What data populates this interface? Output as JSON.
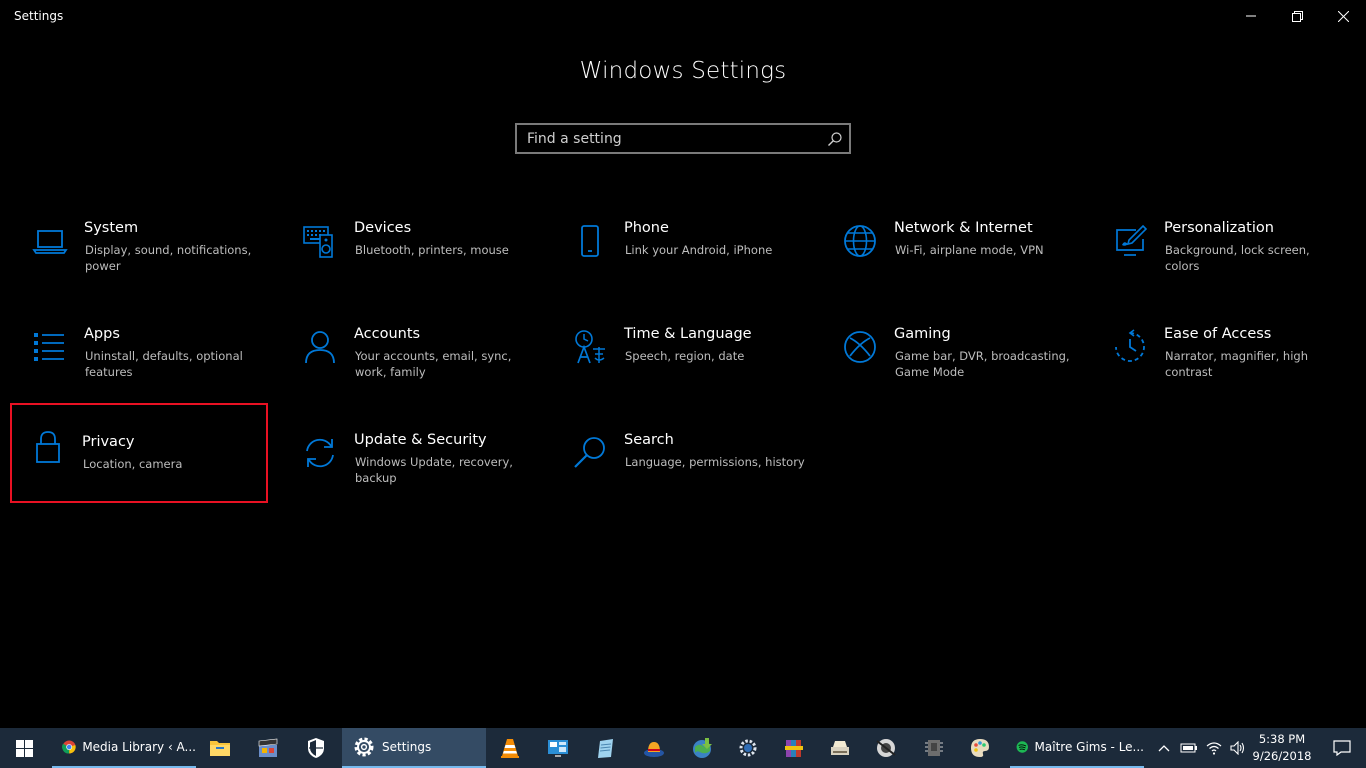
{
  "window": {
    "title": "Settings"
  },
  "header": {
    "title": "Windows Settings"
  },
  "search": {
    "placeholder": "Find a setting"
  },
  "accent_color": "#0078d7",
  "selection_color": "#e81123",
  "tiles": [
    {
      "title": "System",
      "desc": "Display, sound, notifications, power",
      "icon": "laptop-icon"
    },
    {
      "title": "Devices",
      "desc": "Bluetooth, printers, mouse",
      "icon": "keyboard-speaker-icon"
    },
    {
      "title": "Phone",
      "desc": "Link your Android, iPhone",
      "icon": "phone-icon"
    },
    {
      "title": "Network & Internet",
      "desc": "Wi-Fi, airplane mode, VPN",
      "icon": "globe-icon"
    },
    {
      "title": "Personalization",
      "desc": "Background, lock screen, colors",
      "icon": "paintbrush-screen-icon"
    },
    {
      "title": "Apps",
      "desc": "Uninstall, defaults, optional features",
      "icon": "app-list-icon"
    },
    {
      "title": "Accounts",
      "desc": "Your accounts, email, sync, work, family",
      "icon": "person-icon"
    },
    {
      "title": "Time & Language",
      "desc": "Speech, region, date",
      "icon": "time-language-icon"
    },
    {
      "title": "Gaming",
      "desc": "Game bar, DVR, broadcasting, Game Mode",
      "icon": "xbox-icon"
    },
    {
      "title": "Ease of Access",
      "desc": "Narrator, magnifier, high contrast",
      "icon": "ease-of-access-icon"
    },
    {
      "title": "Privacy",
      "desc": "Location, camera",
      "icon": "lock-icon"
    },
    {
      "title": "Update & Security",
      "desc": "Windows Update, recovery, backup",
      "icon": "sync-arrows-icon"
    },
    {
      "title": "Search",
      "desc": "Language, permissions, history",
      "icon": "magnifier-icon"
    }
  ],
  "taskbar": {
    "start": "windows-logo-icon",
    "items": [
      {
        "label": "Media Library ‹ A...",
        "icon": "chrome-icon"
      },
      {
        "label": "Settings",
        "icon": "gear-icon"
      },
      {
        "label": "Maître Gims - Le...",
        "icon": "spotify-icon"
      }
    ],
    "clock_time": "5:38 PM",
    "clock_date": "9/26/2018"
  }
}
